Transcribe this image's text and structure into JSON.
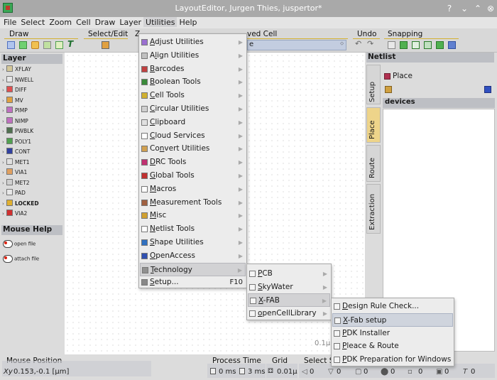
{
  "window": {
    "title": "LayoutEditor, Jurgen Thies, juspertor*",
    "btn_help": "?",
    "btn_min": "⌄",
    "btn_max": "⌃",
    "btn_close": "⊗"
  },
  "menubar": [
    "File",
    "Select",
    "Zoom",
    "Cell",
    "Draw",
    "Layer",
    "Utilities",
    "Help"
  ],
  "toolbar": {
    "groups": {
      "draw": "Draw",
      "select_edit": "Select/Edit",
      "zoom": "Z",
      "cell": "ved Cell",
      "undo": "Undo",
      "snapping": "Snapping"
    },
    "cell_value": "e"
  },
  "layer_panel": {
    "title": "Layer",
    "layers": [
      {
        "name": "XFLAY",
        "color": "#d4c89a"
      },
      {
        "name": "NWELL",
        "color": "#e8e8e8"
      },
      {
        "name": "DIFF",
        "color": "#e05050"
      },
      {
        "name": "MV",
        "color": "#e0a040"
      },
      {
        "name": "PIMP",
        "color": "#c070c0"
      },
      {
        "name": "NIMP",
        "color": "#c070c0"
      },
      {
        "name": "PWBLK",
        "color": "#507050"
      },
      {
        "name": "POLY1",
        "color": "#50a050"
      },
      {
        "name": "CONT",
        "color": "#3040a0"
      },
      {
        "name": "MET1",
        "color": "#e0e0e0"
      },
      {
        "name": "VIA1",
        "color": "#e0a060"
      },
      {
        "name": "MET2",
        "color": "#d0d0d0"
      },
      {
        "name": "PAD",
        "color": "#e8e8e8"
      },
      {
        "name": "LOCKED",
        "color": "#e0b030"
      },
      {
        "name": "VIA2",
        "color": "#d03030"
      }
    ]
  },
  "mouse_help": {
    "title": "Mouse Help",
    "items": [
      "open file",
      "attach file"
    ]
  },
  "canvas": {
    "scale_label": "0.1µ"
  },
  "netlist": {
    "title": "Netlist",
    "tabs": [
      "Setup",
      "Place",
      "Route",
      "Extraction"
    ],
    "place_label": "Place",
    "devices_title": "devices"
  },
  "status": {
    "mouse_position": "Mouse Position",
    "coords": "0.153,-0.1 [µm]",
    "xy": "Xy",
    "process_time": "Process Time",
    "time_a": "0 ms",
    "time_b": "3 ms",
    "grid": "Grid",
    "grid_value": "0.01µ",
    "select_title": "Select St",
    "counts": [
      "0",
      "0",
      "0",
      "0",
      "0",
      "0"
    ]
  },
  "utilities_menu": [
    {
      "label": "Adjust Utilities",
      "ul": "A",
      "rest": "djust Utilities",
      "icon": "#9a6fd0"
    },
    {
      "label": "Align Utilities",
      "ul": "l",
      "pre": "A",
      "rest": "ign Utilities",
      "icon": "#c0c0c0"
    },
    {
      "label": "Barcodes",
      "ul": "B",
      "rest": "arcodes",
      "icon": "#c04040"
    },
    {
      "label": "Boolean Tools",
      "ul": "B",
      "rest": "oolean Tools",
      "icon": "#3a8a3a"
    },
    {
      "label": "Cell Tools",
      "ul": "C",
      "rest": "ell Tools",
      "icon": "#d0b030"
    },
    {
      "label": "Circular Utilities",
      "ul": "C",
      "rest": "ircular Utilities",
      "icon": "#d0d0d0"
    },
    {
      "label": "Clipboard",
      "ul": "C",
      "rest": "lipboard",
      "icon": "#e0e0e0"
    },
    {
      "label": "Cloud Services",
      "ul": "C",
      "rest": "loud Services",
      "icon": "#ffffff"
    },
    {
      "label": "Convert Utilities",
      "ul": "n",
      "pre": "Co",
      "rest": "vert Utilities",
      "icon": "#d0a050"
    },
    {
      "label": "DRC Tools",
      "ul": "D",
      "rest": "RC Tools",
      "icon": "#c03070"
    },
    {
      "label": "Global Tools",
      "ul": "G",
      "rest": "lobal Tools",
      "icon": "#c03030"
    },
    {
      "label": "Macros",
      "ul": "M",
      "rest": "acros",
      "icon": "#ffffff"
    },
    {
      "label": "Measurement Tools",
      "ul": "M",
      "rest": "easurement Tools",
      "icon": "#a06040"
    },
    {
      "label": "Misc",
      "ul": "M",
      "rest": "isc",
      "icon": "#d0a030"
    },
    {
      "label": "Netlist Tools",
      "ul": "N",
      "rest": "etlist Tools",
      "icon": "#ffffff"
    },
    {
      "label": "Shape Utilities",
      "ul": "S",
      "rest": "hape Utilities",
      "icon": "#3070c0"
    },
    {
      "label": "OpenAccess",
      "ul": "O",
      "rest": "penAccess",
      "icon": "#3050b0"
    },
    {
      "label": "Technology",
      "ul": "T",
      "rest": "echnology",
      "icon": "#909090"
    },
    {
      "label": "Setup...",
      "ul": "S",
      "rest": "etup...",
      "icon": "#888888",
      "shortcut": "F10"
    }
  ],
  "technology_menu": [
    {
      "label": "PCB",
      "ul": "P",
      "rest": "CB"
    },
    {
      "label": "SkyWater",
      "ul": "S",
      "rest": "kyWater"
    },
    {
      "label": "X-FAB",
      "ul": "X",
      "rest": "-FAB"
    },
    {
      "label": "openCellLibrary",
      "ul": "o",
      "rest": "penCellLibrary"
    }
  ],
  "xfab_menu": [
    {
      "label": "Design Rule Check...",
      "ul": "D",
      "rest": "esign Rule Check..."
    },
    {
      "label": "X-Fab setup",
      "ul": "X",
      "rest": "-Fab setup"
    },
    {
      "label": "PDK Installer",
      "ul": "P",
      "rest": "DK Installer"
    },
    {
      "label": "Pleace & Route",
      "ul": "P",
      "rest": "leace & Route"
    },
    {
      "label": "PDK Preparation for Windows",
      "ul": "P",
      "rest": "DK Preparation for Windows"
    }
  ]
}
